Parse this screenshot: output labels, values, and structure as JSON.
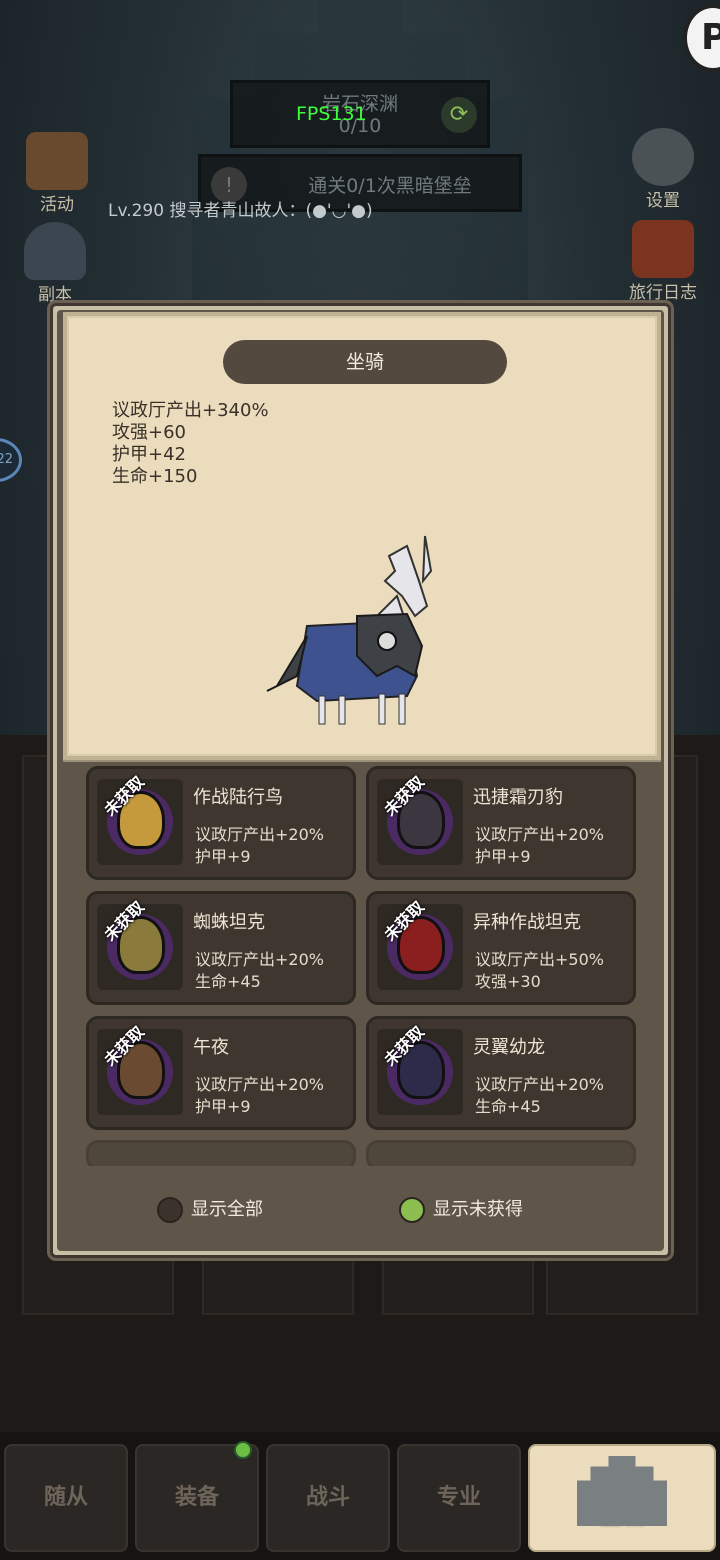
{
  "hud": {
    "zone_title": "岩石深渊",
    "zone_count": "0/10",
    "fps": "FPS131",
    "quest": "通关0/1次黑暗堡垒",
    "player": "Lv.290 搜寻者青山故人：(●'◡'●)"
  },
  "side_menu": {
    "activity": "活动",
    "dungeon": "副本",
    "settings": "设置",
    "journal": "旅行日志",
    "badge": "22"
  },
  "modal": {
    "title": "坐骑",
    "stats": [
      "议政厅产出+340%",
      "攻强+60",
      "护甲+42",
      "生命+150"
    ],
    "cards": [
      {
        "ribbon": "未获取",
        "name": "作战陆行鸟",
        "stat1": "议政厅产出+20%",
        "stat2": "护甲+9",
        "color": "#c49a3c"
      },
      {
        "ribbon": "未获取",
        "name": "迅捷霜刃豹",
        "stat1": "议政厅产出+20%",
        "stat2": "护甲+9",
        "color": "#3b3640"
      },
      {
        "ribbon": "未获取",
        "name": "蜘蛛坦克",
        "stat1": "议政厅产出+20%",
        "stat2": "生命+45",
        "color": "#8a7a3c"
      },
      {
        "ribbon": "未获取",
        "name": "异种作战坦克",
        "stat1": "议政厅产出+50%",
        "stat2": "攻强+30",
        "color": "#8b1f1f"
      },
      {
        "ribbon": "未获取",
        "name": "午夜",
        "stat1": "议政厅产出+20%",
        "stat2": "护甲+9",
        "color": "#6b4a32"
      },
      {
        "ribbon": "未获取",
        "name": "灵翼幼龙",
        "stat1": "议政厅产出+20%",
        "stat2": "生命+45",
        "color": "#2e2a4a"
      }
    ],
    "filter_all": "显示全部",
    "filter_unowned": "显示未获得"
  },
  "nav": {
    "followers": "随从",
    "equipment": "装备",
    "battle": "战斗",
    "profession": "专业",
    "main_city": "主城"
  },
  "colors": {
    "accent_green": "#8cbf4f",
    "fps_green": "#3bff3b",
    "parchment": "#eadcbc"
  }
}
